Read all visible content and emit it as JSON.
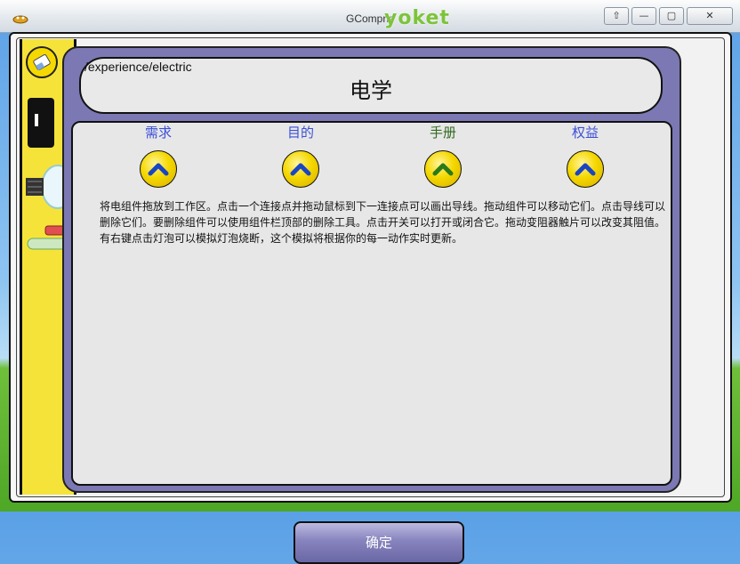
{
  "window": {
    "title": "GCompris",
    "brand": "yoket",
    "buttons": [
      "⇧",
      "—",
      "▢",
      "✕"
    ]
  },
  "dialog": {
    "path": "/experience/electric",
    "title": "电学",
    "tabs": [
      {
        "label": "需求",
        "active": false
      },
      {
        "label": "目的",
        "active": false
      },
      {
        "label": "手册",
        "active": true
      },
      {
        "label": "权益",
        "active": false
      }
    ],
    "description": "将电组件拖放到工作区。点击一个连接点并拖动鼠标到下一连接点可以画出导线。拖动组件可以移动它们。点击导线可以删除它们。要删除组件可以使用组件栏顶部的删除工具。点击开关可以打开或闭合它。拖动变阻器触片可以改变其阻值。有右键点击灯泡可以模拟灯泡烧断，这个模拟将根据你的每一动作实时更新。",
    "ok_label": "确定"
  },
  "colors": {
    "dialog_bg": "#7b78b4",
    "toolbar": "#f6e33a",
    "tab_label": "#3b4fd8",
    "tab_active": "#2f6b1f"
  }
}
